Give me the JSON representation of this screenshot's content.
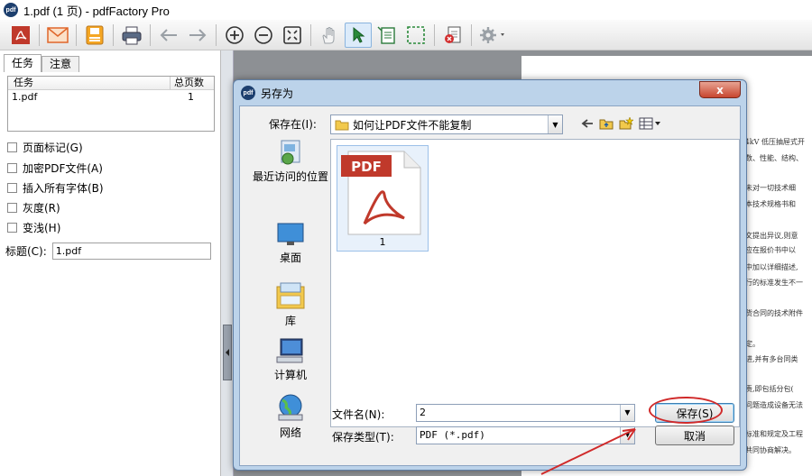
{
  "window": {
    "app_badge": "pdf",
    "title": "1.pdf (1 页) - pdfFactory Pro"
  },
  "left_panel": {
    "tabs": [
      "任务",
      "注意"
    ],
    "columns": [
      "任务",
      "总页数"
    ],
    "rows": [
      {
        "task": "1.pdf",
        "pages": "1"
      }
    ],
    "options": [
      "页面标记(G)",
      "加密PDF文件(A)",
      "插入所有字体(B)",
      "灰度(R)",
      "变浅(H)"
    ],
    "title_label": "标题(C):",
    "title_value": "1.pdf"
  },
  "preview_text": [
    "0.4kV 低压抽屉式开",
    "参数、性能、结构、",
    "并未对一切技术细",
    "合本技术规格书和",
    "条文提出异议,则意",
    "都应在报价书中以",
    "书中加以详细描述,",
    "执行的标准发生不一",
    "订货合同的技术附件",
    "指定。",
    "先进,并有多台同类",
    "全责,即包括分包(",
    "技问题造成设备无法",
    "的标准和规定及工程",
    "方共同协商解决。"
  ],
  "dialog": {
    "badge": "pdf",
    "title": "另存为",
    "close": "x",
    "save_in_label": "保存在(I):",
    "save_in_value": "如何让PDF文件不能复制",
    "places": [
      "最近访问的位置",
      "桌面",
      "库",
      "计算机",
      "网络"
    ],
    "file": {
      "icon_text": "PDF",
      "name": "1"
    },
    "filename_label": "文件名(N):",
    "filename_value": "2",
    "filetype_label": "保存类型(T):",
    "filetype_value": "PDF (*.pdf)",
    "save_button": "保存(S)",
    "cancel_button": "取消"
  },
  "colors": {
    "accent": "#3c7fb1",
    "annotation": "#d02a2a",
    "pdf_red": "#c0392b"
  }
}
